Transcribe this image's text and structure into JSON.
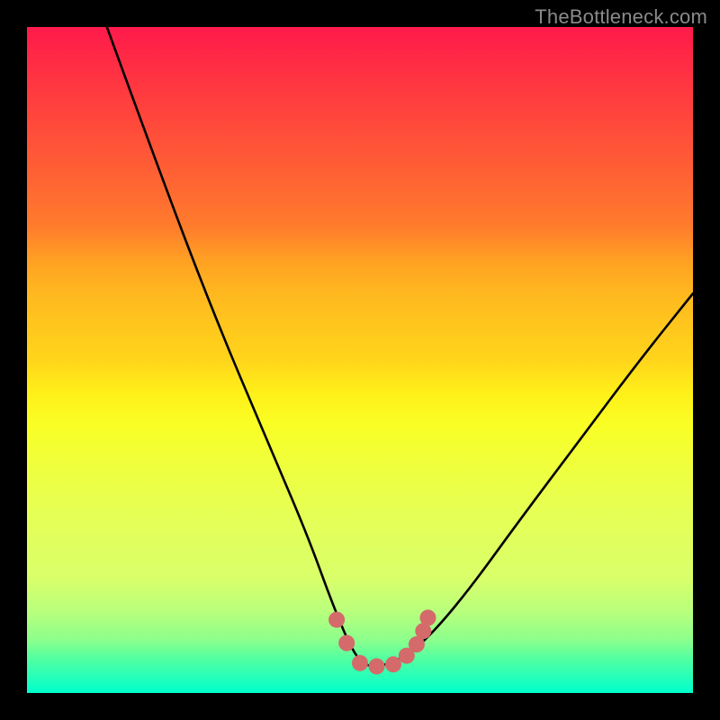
{
  "watermark": {
    "text": "TheBottleneck.com"
  },
  "colors": {
    "page_bg": "#000000",
    "curve_stroke": "#000000",
    "marker_fill": "#d46a6a",
    "gradient_stops": [
      "#ff1a4b",
      "#ff3b3f",
      "#ff5a36",
      "#ff7c2c",
      "#ffa023",
      "#ffb81f",
      "#ffd51b",
      "#fff019",
      "#f9ff25",
      "#f0ff3a",
      "#e7ff52",
      "#d8ff6b",
      "#b7ff7d",
      "#8cff8c",
      "#4fffa2",
      "#00ffce"
    ]
  },
  "chart_data": {
    "type": "line",
    "title": "",
    "xlabel": "",
    "ylabel": "",
    "xlim": [
      0,
      100
    ],
    "ylim": [
      0,
      100
    ],
    "grid": false,
    "legend": false,
    "annotations": [],
    "series": [
      {
        "name": "curve",
        "x": [
          12,
          20,
          28,
          36,
          42,
          46,
          49,
          51,
          53,
          56,
          60,
          66,
          74,
          83,
          92,
          100
        ],
        "y": [
          100,
          78,
          57,
          38,
          24,
          13,
          6,
          4,
          4,
          5,
          8,
          15,
          26,
          38,
          50,
          60
        ]
      }
    ],
    "markers": {
      "name": "highlight",
      "x": [
        46.5,
        48.0,
        50.0,
        52.5,
        55.0,
        57.0,
        58.5,
        59.5,
        60.2
      ],
      "y": [
        11.0,
        7.5,
        4.5,
        4.0,
        4.3,
        5.6,
        7.3,
        9.3,
        11.3
      ]
    }
  }
}
